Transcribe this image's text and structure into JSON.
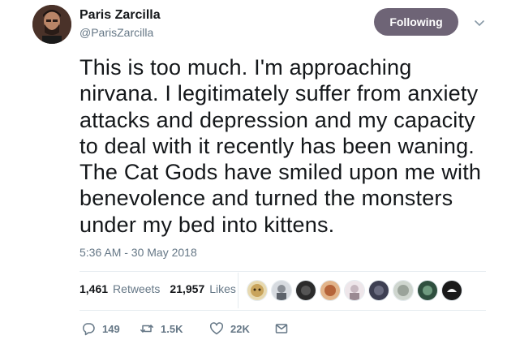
{
  "author": {
    "display_name": "Paris Zarcilla",
    "handle": "@ParisZarcilla",
    "avatar_icon": "user-avatar-photo"
  },
  "follow_button": {
    "label": "Following",
    "color": "#6e6476"
  },
  "menu_icon": "chevron-down-icon",
  "tweet": {
    "lines": [
      "This is too much. I'm approaching",
      "nirvana. I legitimately suffer from anxiety",
      "attacks and depression and my capacity",
      "to deal with it recently has been waning.",
      "The Cat Gods have smiled upon me with",
      "benevolence and turned the monsters",
      "under my bed into kittens."
    ],
    "timestamp": "5:36 AM - 30 May 2018"
  },
  "stats": {
    "retweets_count": "1,461",
    "retweets_label": "Retweets",
    "likes_count": "21,957",
    "likes_label": "Likes"
  },
  "likers": [
    {
      "icon": "liker-avatar-1",
      "color": "#c9a45c"
    },
    {
      "icon": "liker-avatar-2",
      "color": "#8a8f96"
    },
    {
      "icon": "liker-avatar-3",
      "color": "#2b2b2b"
    },
    {
      "icon": "liker-avatar-4",
      "color": "#b5643a"
    },
    {
      "icon": "liker-avatar-5",
      "color": "#c7b8c0"
    },
    {
      "icon": "liker-avatar-6",
      "color": "#3d3f52"
    },
    {
      "icon": "liker-avatar-7",
      "color": "#9aa39a"
    },
    {
      "icon": "liker-avatar-8",
      "color": "#2f4f3f"
    },
    {
      "icon": "liker-avatar-9",
      "color": "#1a1a1a"
    }
  ],
  "actions": {
    "reply_count": "149",
    "retweet_count": "1.5K",
    "like_count": "22K"
  }
}
